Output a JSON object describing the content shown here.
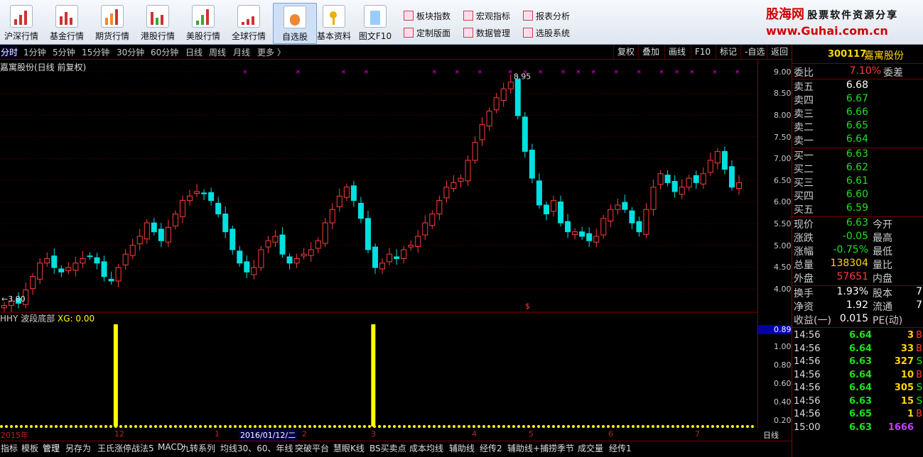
{
  "toolbar": {
    "buttons": [
      "沪深行情",
      "基金行情",
      "期货行情",
      "港股行情",
      "美股行情",
      "全球行情",
      "自选股",
      "基本资料",
      "图文F10"
    ],
    "small": [
      "板块指数",
      "宏观指标",
      "报表分析",
      "定制版面",
      "数据管理",
      "选股系统"
    ]
  },
  "brand": {
    "name": "股海网",
    "tagline": "股票软件资源分享",
    "url": "www.Guhai.com.cn"
  },
  "periods": [
    "分时",
    "1分钟",
    "5分钟",
    "15分钟",
    "30分钟",
    "60分钟",
    "日线",
    "周线",
    "月线",
    "更多 〉"
  ],
  "chart_buttons": [
    "复权",
    "叠加",
    "画线",
    "F10",
    "标记",
    "-自选",
    "返回"
  ],
  "chart": {
    "title": "嘉寓股份(日线 前复权)",
    "high_label": "8.95",
    "low_label": "←3.80",
    "signal_mark": "$",
    "y_ticks": [
      "9.00",
      "8.50",
      "8.00",
      "7.50",
      "7.00",
      "6.50",
      "6.00",
      "5.50",
      "5.00",
      "4.50",
      "4.00"
    ],
    "indicator_name": "HHY 波段底部",
    "indicator_value": "XG: 0.00",
    "ind_current": "0.89",
    "ind_ticks": [
      "1.00",
      "0.80",
      "0.60",
      "0.40",
      "0.20"
    ],
    "x_labels": [
      "2015年",
      "12",
      "1",
      "2016/01/12/二",
      "2",
      "3",
      "4",
      "5",
      "6",
      "7"
    ],
    "period_label": "日线"
  },
  "chart_data": {
    "type": "candlestick",
    "security": "嘉寓股份",
    "period": "日线 前复权",
    "ylim": [
      3.8,
      9.2
    ],
    "x_labels": [
      "2015年",
      "12",
      "1",
      "2016/01/12/二",
      "2",
      "3",
      "4",
      "5",
      "6",
      "7"
    ],
    "closes": [
      3.95,
      4.05,
      4.0,
      4.3,
      4.6,
      4.9,
      5.0,
      4.8,
      4.7,
      4.8,
      4.9,
      5.0,
      5.05,
      4.9,
      4.6,
      4.5,
      4.8,
      5.1,
      5.3,
      5.5,
      5.8,
      5.6,
      5.4,
      5.7,
      6.0,
      6.3,
      6.4,
      6.5,
      6.45,
      6.3,
      6.0,
      5.6,
      5.2,
      4.9,
      4.7,
      4.8,
      5.2,
      5.4,
      5.5,
      5.1,
      4.9,
      5.0,
      5.1,
      5.2,
      5.4,
      5.8,
      6.1,
      6.4,
      6.6,
      6.3,
      5.9,
      5.2,
      4.8,
      4.9,
      5.1,
      5.0,
      5.2,
      5.3,
      5.5,
      5.8,
      6.0,
      6.3,
      6.6,
      6.7,
      6.8,
      7.2,
      7.6,
      8.0,
      8.3,
      8.6,
      8.8,
      8.95,
      8.2,
      7.4,
      6.8,
      6.2,
      6.0,
      6.3,
      5.8,
      5.6,
      5.6,
      5.5,
      5.4,
      5.5,
      5.9,
      6.1,
      6.2,
      6.1,
      5.8,
      5.6,
      6.1,
      6.6,
      6.9,
      6.7,
      6.5,
      6.6,
      6.8,
      6.7,
      6.9,
      7.2,
      7.4,
      7.0,
      6.6,
      6.7
    ],
    "indicator": {
      "name": "HHY 波段底部",
      "XG": 0.0,
      "signal_ratio_positions": [
        0.15,
        0.49
      ]
    }
  },
  "quote": {
    "code": "300117",
    "name": "嘉寓股份",
    "weibi": {
      "label": "委比",
      "value": "7.10%",
      "label2": "委差"
    },
    "asks": [
      {
        "l": "卖五",
        "v": "6.68"
      },
      {
        "l": "卖四",
        "v": "6.67"
      },
      {
        "l": "卖三",
        "v": "6.66"
      },
      {
        "l": "卖二",
        "v": "6.65"
      },
      {
        "l": "卖一",
        "v": "6.64"
      }
    ],
    "bids": [
      {
        "l": "买一",
        "v": "6.63"
      },
      {
        "l": "买二",
        "v": "6.62"
      },
      {
        "l": "买三",
        "v": "6.61"
      },
      {
        "l": "买四",
        "v": "6.60"
      },
      {
        "l": "买五",
        "v": "6.59"
      }
    ],
    "stats": [
      {
        "l": "现价",
        "v": "6.63",
        "l2": "今开"
      },
      {
        "l": "涨跌",
        "v": "-0.05",
        "l2": "最高"
      },
      {
        "l": "涨幅",
        "v": "-0.75%",
        "l2": "最低"
      },
      {
        "l": "总量",
        "v": "138304",
        "l2": "量比"
      },
      {
        "l": "外盘",
        "v": "57651",
        "l2": "内盘"
      }
    ],
    "stats2": [
      {
        "l": "换手",
        "v": "1.93%",
        "l2": "股本",
        "v2": "7"
      },
      {
        "l": "净资",
        "v": "1.92",
        "l2": "流通",
        "v2": "7"
      },
      {
        "l": "收益(一)",
        "v": "0.015",
        "l2": "PE(动)",
        "v2": ""
      }
    ],
    "ticks": [
      {
        "t": "14:56",
        "p": "6.64",
        "q": "3",
        "s": "B"
      },
      {
        "t": "14:56",
        "p": "6.64",
        "q": "33",
        "s": "B"
      },
      {
        "t": "14:56",
        "p": "6.63",
        "q": "327",
        "s": "S"
      },
      {
        "t": "14:56",
        "p": "6.64",
        "q": "10",
        "s": "B"
      },
      {
        "t": "14:56",
        "p": "6.64",
        "q": "305",
        "s": "S"
      },
      {
        "t": "14:56",
        "p": "6.63",
        "q": "15",
        "s": "S"
      },
      {
        "t": "14:56",
        "p": "6.65",
        "q": "1",
        "s": "B"
      },
      {
        "t": "15:00",
        "p": "6.63",
        "q": "1666",
        "s": ""
      }
    ]
  },
  "tabs": [
    "指标",
    "模板",
    "管理",
    "另存为",
    "王氏涨停战法5",
    "MACD",
    "九转系列",
    "均线30、60、年线",
    "突破平台",
    "慧眼K线",
    "BS买卖点",
    "成本均线",
    "辅助线",
    "经传2",
    "辅助线+捕捞季节",
    "成交量",
    "经传1"
  ]
}
